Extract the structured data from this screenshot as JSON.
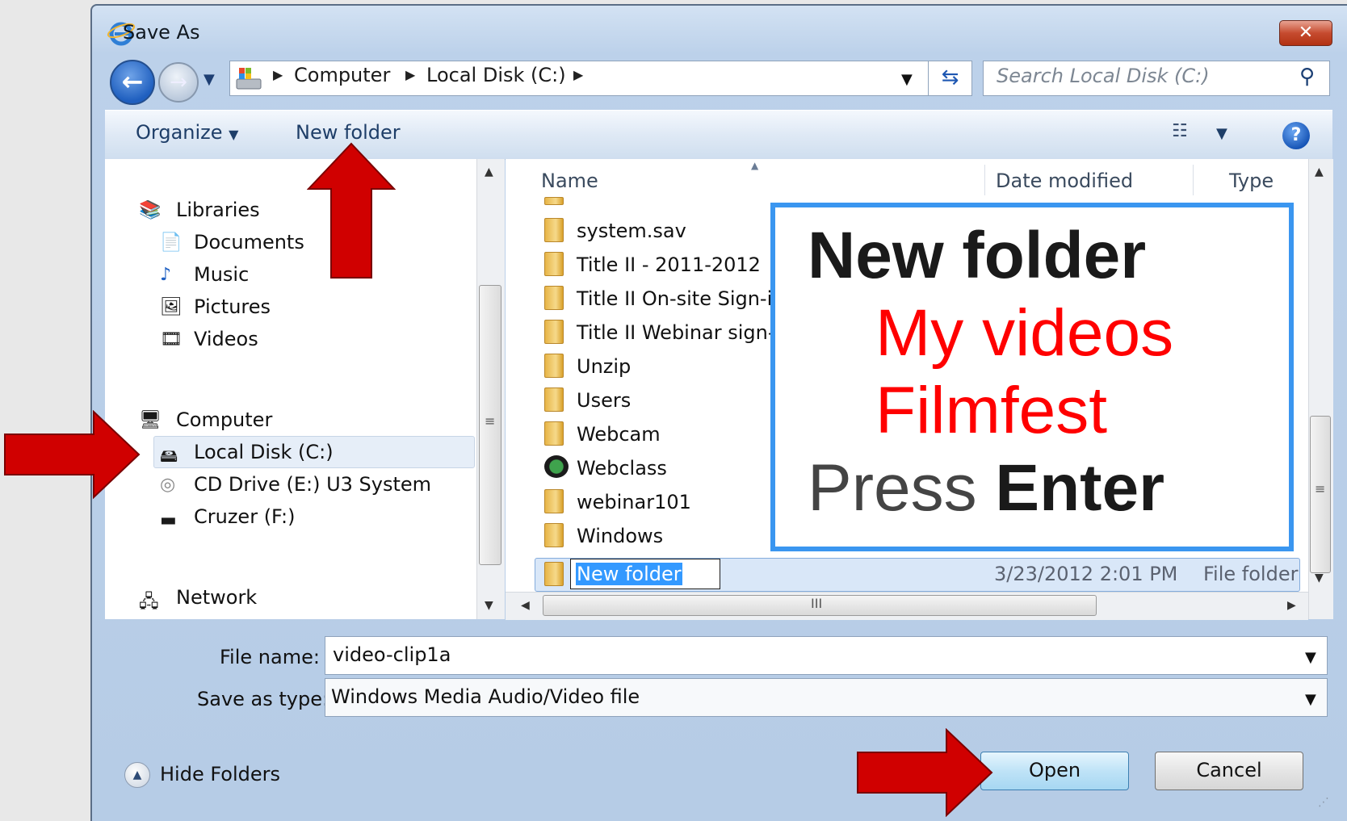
{
  "window": {
    "title": "Save As",
    "close_label": "✕"
  },
  "nav": {
    "back_icon": "arrow-left-icon",
    "forward_icon": "arrow-right-icon",
    "breadcrumb": [
      "Computer",
      "Local Disk (C:)"
    ],
    "search_placeholder": "Search Local Disk (C:)"
  },
  "toolbar": {
    "organize_label": "Organize",
    "new_folder_label": "New folder"
  },
  "nav_pane": {
    "libraries_label": "Libraries",
    "library_items": [
      "Documents",
      "Music",
      "Pictures",
      "Videos"
    ],
    "computer_label": "Computer",
    "computer_items": [
      "Local Disk (C:)",
      "CD Drive (E:) U3 System",
      "Cruzer (F:)"
    ],
    "network_label": "Network",
    "selected": "Local Disk (C:)"
  },
  "file_list": {
    "columns": [
      "Name",
      "Date modified",
      "Type"
    ],
    "items": [
      {
        "name": "system.sav",
        "icon": "folder-icon"
      },
      {
        "name": "Title II - 2011-2012",
        "icon": "folder-icon"
      },
      {
        "name": "Title II On-site Sign-i",
        "icon": "folder-icon"
      },
      {
        "name": "Title II Webinar sign-i",
        "icon": "folder-icon"
      },
      {
        "name": "Unzip",
        "icon": "folder-icon"
      },
      {
        "name": "Users",
        "icon": "folder-icon"
      },
      {
        "name": "Webcam",
        "icon": "folder-icon"
      },
      {
        "name": "Webclass",
        "icon": "webclass-icon"
      },
      {
        "name": "webinar101",
        "icon": "folder-icon"
      },
      {
        "name": "Windows",
        "icon": "folder-icon"
      }
    ],
    "new_folder_row": {
      "name": "New folder",
      "date_modified": "3/23/2012 2:01 PM",
      "type": "File folder"
    },
    "hscroll_grip": "III",
    "vscroll_grip": "≡"
  },
  "form": {
    "file_name_label": "File name:",
    "file_name_value": "video-clip1a",
    "save_type_label": "Save as type:",
    "save_type_value": "Windows Media Audio/Video file"
  },
  "footer": {
    "hide_folders_label": "Hide Folders",
    "open_label": "Open",
    "cancel_label": "Cancel"
  },
  "callout": {
    "line1": "New folder",
    "line2": "My videos",
    "line3": "Filmfest",
    "line4_prefix": "Press ",
    "line4_key": "Enter"
  },
  "colors": {
    "arrow": "#d00000",
    "callout_border": "#3a96f0",
    "callout_highlight": "#ff0000"
  }
}
